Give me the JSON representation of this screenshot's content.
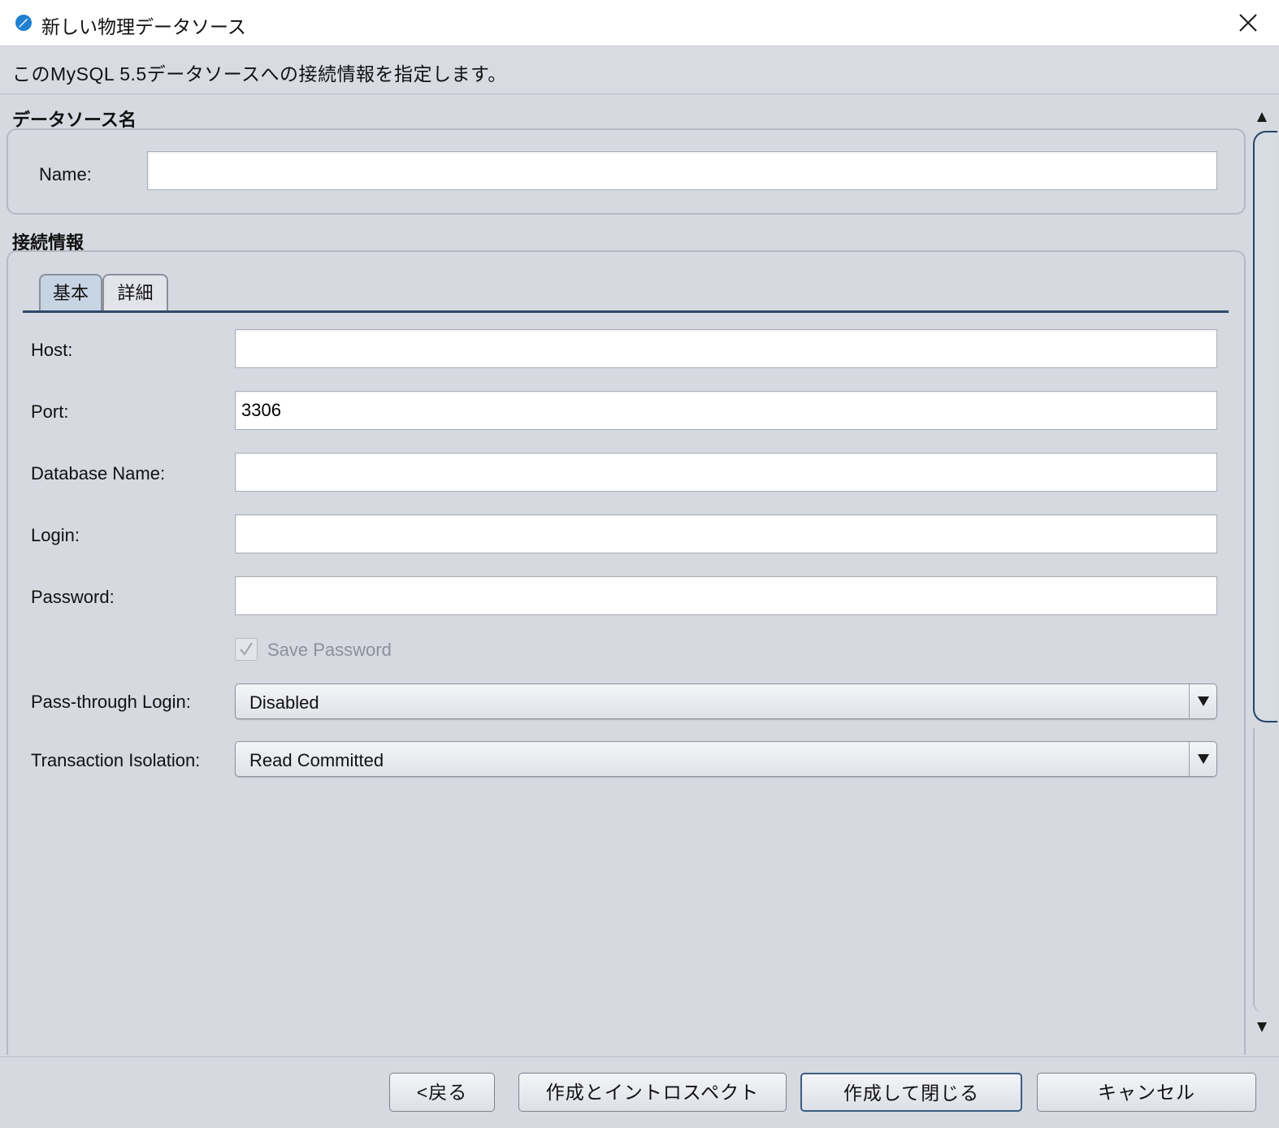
{
  "window": {
    "title": "新しい物理データソース",
    "app_icon": "app-logo-icon",
    "close_icon": "close-icon"
  },
  "instruction": "このMySQL 5.5データソースへの接続情報を指定します。",
  "datasource_section": {
    "title": "データソース名",
    "name_label": "Name:",
    "name_value": ""
  },
  "connection_section": {
    "title": "接続情報",
    "tabs": [
      {
        "label": "基本",
        "active": true
      },
      {
        "label": "詳細",
        "active": false
      }
    ],
    "fields": {
      "host_label": "Host:",
      "host_value": "",
      "port_label": "Port:",
      "port_value": "3306",
      "database_label": "Database Name:",
      "database_value": "",
      "login_label": "Login:",
      "login_value": "",
      "password_label": "Password:",
      "password_value": "",
      "save_password_label": "Save Password",
      "save_password_checked": true,
      "save_password_enabled": false,
      "passthrough_label": "Pass-through Login:",
      "passthrough_value": "Disabled",
      "isolation_label": "Transaction Isolation:",
      "isolation_value": "Read Committed"
    }
  },
  "buttons": {
    "back": "<戻る",
    "create_introspect": "作成とイントロスペクト",
    "create_close": "作成して閉じる",
    "cancel": "キャンセル"
  },
  "colors": {
    "background": "#d6d9e0",
    "active_tab": "#c7d4e3",
    "accent_dark": "#23456a",
    "app_icon_blue": "#1f7fd1"
  }
}
